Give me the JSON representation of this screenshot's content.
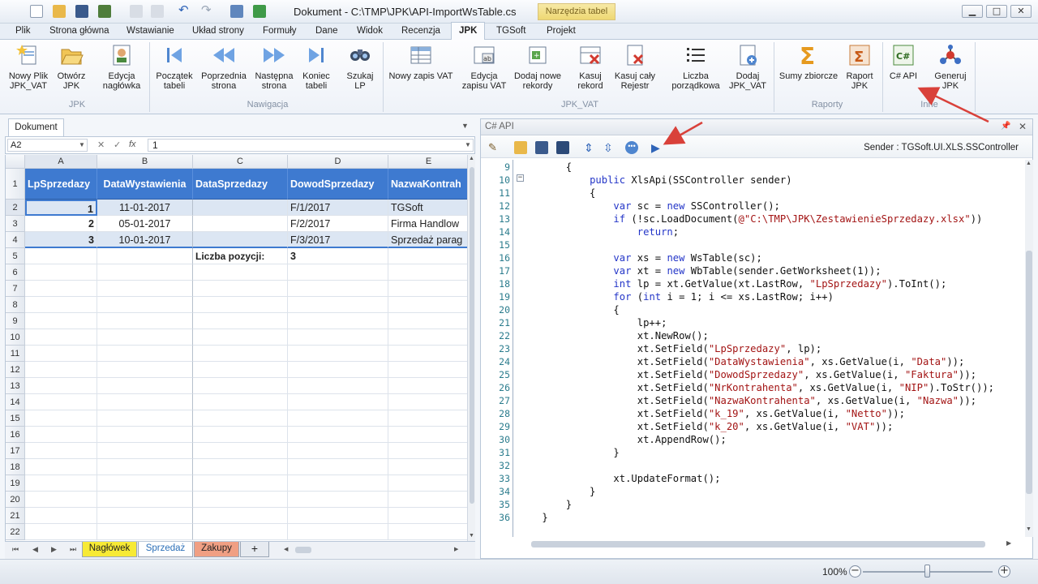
{
  "window": {
    "title": "Dokument - C:\\TMP\\JPK\\API-ImportWsTable.cs",
    "context_tab": "Narzędzia tabel",
    "minimize": "▁",
    "maximize": "□",
    "close": "✕"
  },
  "ribbon_tabs": [
    "Plik",
    "Strona główna",
    "Wstawianie",
    "Układ strony",
    "Formuły",
    "Dane",
    "Widok",
    "Recenzja",
    "JPK",
    "TGSoft",
    "Projekt"
  ],
  "ribbon": {
    "groups": {
      "jpk": "JPK",
      "nawigacja": "Nawigacja",
      "jpk_vat": "JPK_VAT",
      "raporty": "Raporty",
      "inne": "Inne"
    },
    "buttons": {
      "nowy_plik": [
        "Nowy Plik",
        "JPK_VAT"
      ],
      "otworz": [
        "Otwórz",
        "JPK"
      ],
      "edycja_naglowka": [
        "Edycja",
        "nagłówka"
      ],
      "poczatek": [
        "Początek",
        "tabeli"
      ],
      "poprzednia": [
        "Poprzednia",
        "strona"
      ],
      "nastepna": [
        "Następna",
        "strona"
      ],
      "koniec": [
        "Koniec",
        "tabeli"
      ],
      "szukaj": [
        "Szukaj",
        "LP"
      ],
      "nowy_zapis": [
        "Nowy zapis VAT",
        ""
      ],
      "edycja_zapisu": [
        "Edycja",
        "zapisu VAT"
      ],
      "dodaj_nowe": [
        "Dodaj nowe",
        "rekordy"
      ],
      "kasuj_rekord": [
        "Kasuj",
        "rekord"
      ],
      "kasuj_rejestr": [
        "Kasuj cały",
        "Rejestr"
      ],
      "liczba": [
        "Liczba",
        "porządkowa"
      ],
      "dodaj_jpk": [
        "Dodaj",
        "JPK_VAT"
      ],
      "sumy": [
        "Sumy zbiorcze",
        ""
      ],
      "raport": [
        "Raport",
        "JPK"
      ],
      "csapi": [
        "C# API",
        ""
      ],
      "generuj": [
        "Generuj",
        "JPK"
      ]
    }
  },
  "left": {
    "doc_tab": "Dokument",
    "namebox": "A2",
    "formula_icons": [
      "✕",
      "✓",
      "fx"
    ],
    "formula_value": "1",
    "columns": [
      "A",
      "B",
      "C",
      "D",
      "E"
    ],
    "rows": [
      "1",
      "2",
      "3",
      "4",
      "5",
      "6",
      "7",
      "8",
      "9",
      "10",
      "11",
      "12",
      "13",
      "14",
      "15",
      "16",
      "17",
      "18",
      "19",
      "20",
      "21",
      "22"
    ],
    "table_header": [
      "LpSprzedazy",
      "DataWystawienia",
      "DataSprzedazy",
      "DowodSprzedazy",
      "NazwaKontrah"
    ],
    "table_rows": [
      [
        "1",
        "11-01-2017",
        "",
        "F/1/2017",
        "TGSoft"
      ],
      [
        "2",
        "05-01-2017",
        "",
        "F/2/2017",
        "Firma Handlow"
      ],
      [
        "3",
        "10-01-2017",
        "",
        "F/3/2017",
        "Sprzedaż parag"
      ]
    ],
    "summary_label": "Liczba pozycji:",
    "summary_value": "3",
    "sheet_tabs": [
      "Nagłówek",
      "Sprzedaż",
      "Zakupy",
      "+"
    ]
  },
  "right": {
    "title": "C# API",
    "sender": "Sender : TGSoft.UI.XLS.SSController",
    "line_numbers": [
      "9",
      "10",
      "11",
      "12",
      "13",
      "14",
      "15",
      "16",
      "17",
      "18",
      "19",
      "20",
      "21",
      "22",
      "23",
      "24",
      "25",
      "26",
      "27",
      "28",
      "29",
      "30",
      "31",
      "32",
      "33",
      "34",
      "35",
      "36"
    ],
    "code_lines": [
      "        {",
      "            public XlsApi(SSController sender)",
      "            {",
      "                var sc = new SSController();",
      "                if (!sc.LoadDocument(@\"C:\\TMP\\JPK\\ZestawienieSprzedazy.xlsx\"))",
      "                    return;",
      "",
      "                var xs = new WsTable(sc);",
      "                var xt = new WbTable(sender.GetWorksheet(1));",
      "                int lp = xt.GetValue(xt.LastRow, \"LpSprzedazy\").ToInt();",
      "                for (int i = 1; i <= xs.LastRow; i++)",
      "                {",
      "                    lp++;",
      "                    xt.NewRow();",
      "                    xt.SetField(\"LpSprzedazy\", lp);",
      "                    xt.SetField(\"DataWystawienia\", xs.GetValue(i, \"Data\"));",
      "                    xt.SetField(\"DowodSprzedazy\", xs.GetValue(i, \"Faktura\"));",
      "                    xt.SetField(\"NrKontrahenta\", xs.GetValue(i, \"NIP\").ToStr());",
      "                    xt.SetField(\"NazwaKontrahenta\", xs.GetValue(i, \"Nazwa\"));",
      "                    xt.SetField(\"k_19\", xs.GetValue(i, \"Netto\"));",
      "                    xt.SetField(\"k_20\", xs.GetValue(i, \"VAT\"));",
      "                    xt.AppendRow();",
      "                }",
      "",
      "                xt.UpdateFormat();",
      "            }",
      "        }",
      "    }"
    ]
  },
  "status": {
    "zoom": "100%",
    "zoom_out": "−",
    "zoom_in": "+",
    "zoom_fraction": 0.5
  }
}
